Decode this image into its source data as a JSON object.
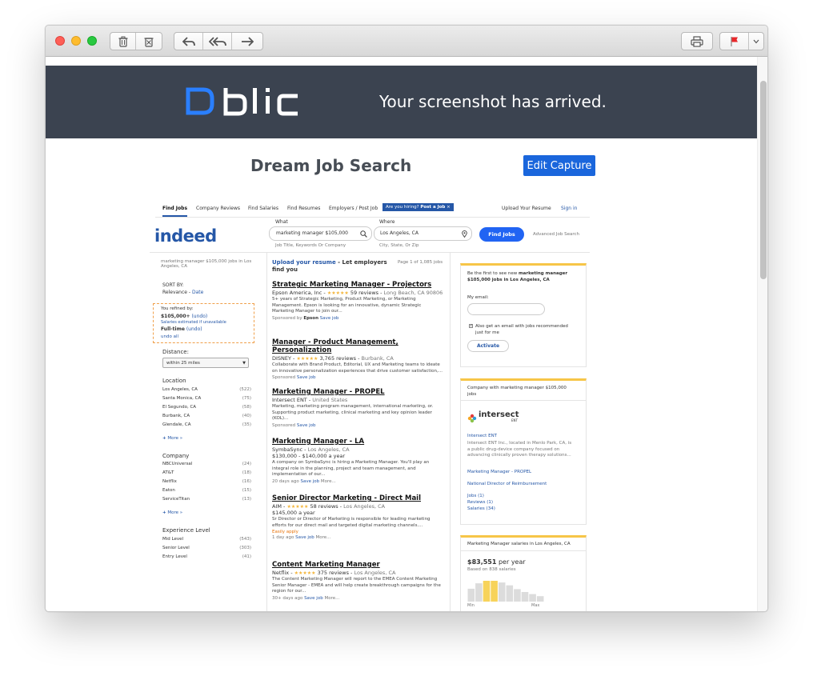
{
  "toolbar": {
    "icons": [
      "trash-icon",
      "junk-icon",
      "reply-icon",
      "reply-all-icon",
      "forward-icon",
      "print-icon",
      "flag-icon",
      "chevron-down-icon"
    ],
    "colors": {
      "close": "#fe5f57",
      "minimize": "#febc2e",
      "zoom": "#28c840",
      "flag": "#e8282b"
    }
  },
  "banner": {
    "logo_text": "blic",
    "tagline": "Your screenshot has arrived.",
    "background": "#3b4350",
    "logo_accent": "#2a7fff"
  },
  "page": {
    "title": "Dream Job Search",
    "edit_button": "Edit Capture"
  },
  "indeed": {
    "nav": {
      "items": [
        "Find Jobs",
        "Company Reviews",
        "Find Salaries",
        "Find Resumes",
        "Employers / Post Job"
      ],
      "hiring_prompt": "Are you hiring?",
      "post_job": "Post a Job",
      "close": "×",
      "upload_resume": "Upload Your Resume",
      "sign_in": "Sign in"
    },
    "logo": "indeed",
    "search": {
      "what_label": "What",
      "what_value": "marketing manager $105,000",
      "what_hint": "Job Title, Keywords Or Company",
      "where_label": "Where",
      "where_value": "Los Angeles, CA",
      "where_hint": "City, State, Or Zip",
      "find_button": "Find Jobs",
      "advanced": "Advanced Job Search"
    },
    "left": {
      "breadcrumb_line1": "marketing manager $105,000 jobs in Los",
      "breadcrumb_line2": "Angeles, CA",
      "sort_label": "SORT BY:",
      "sort_relevance": "Relevance",
      "sort_sep": " - ",
      "sort_date": "Date",
      "refined_label": "You refined by:",
      "refined_salary": "$105,000+",
      "undo": "(undo)",
      "salary_note": "Salaries estimated if unavailable",
      "refined_type": "Full-time",
      "undo_all": "undo all",
      "distance_label": "Distance:",
      "distance_value": "within 25 miles",
      "location_title": "Location",
      "locations": [
        {
          "name": "Los Angeles, CA",
          "count": "(522)"
        },
        {
          "name": "Santa Monica, CA",
          "count": "(75)"
        },
        {
          "name": "El Segundo, CA",
          "count": "(58)"
        },
        {
          "name": "Burbank, CA",
          "count": "(40)"
        },
        {
          "name": "Glendale, CA",
          "count": "(35)"
        }
      ],
      "more": "More »",
      "company_title": "Company",
      "companies": [
        {
          "name": "NBCUniversal",
          "count": "(24)"
        },
        {
          "name": "AT&T",
          "count": "(18)"
        },
        {
          "name": "Netflix",
          "count": "(16)"
        },
        {
          "name": "Eaton",
          "count": "(15)"
        },
        {
          "name": "ServiceTitan",
          "count": "(13)"
        }
      ],
      "experience_title": "Experience Level",
      "experience": [
        {
          "name": "Mid Level",
          "count": "(543)"
        },
        {
          "name": "Senior Level",
          "count": "(303)"
        },
        {
          "name": "Entry Level",
          "count": "(41)"
        }
      ]
    },
    "results": {
      "upload_link": "Upload your resume",
      "upload_rest": " - Let employers",
      "upload_rest2": "find you",
      "page_info": "Page 1 of 1,085 jobs",
      "jobs": [
        {
          "title": "Strategic Marketing Manager - Projectors",
          "company": "Epson America, Inc -",
          "stars": "★★★★★",
          "reviews": "59 reviews -",
          "location": "Long Beach, CA 90806",
          "salary": "",
          "desc": "5+ years of Strategic Marketing, Product Marketing, or Marketing Management. Epson is looking for an innovative, dynamic Strategic Marketing Manager to join our...",
          "meta": "Sponsored by",
          "meta_bold": "Epson",
          "save": "Save job",
          "more": "",
          "easy": ""
        },
        {
          "title": "Manager - Product Management, Personalization",
          "company": "DISNEY -",
          "stars": "★★★★★",
          "reviews": "3,765 reviews -",
          "location": "Burbank, CA",
          "salary": "",
          "desc": "Collaborate with Brand Product, Editorial, UX and Marketing teams to ideate on innovative personalization experiences that drive customer satisfaction,...",
          "meta": "Sponsored",
          "meta_bold": "",
          "save": "Save job",
          "more": "",
          "easy": ""
        },
        {
          "title": "Marketing Manager - PROPEL",
          "company": "Intersect ENT -",
          "stars": "",
          "reviews": "",
          "location": "United States",
          "salary": "",
          "desc": "Marketing, marketing program management, international marketing, or. Supporting product marketing, clinical marketing and key opinion leader (KOL)...",
          "meta": "Sponsored",
          "meta_bold": "",
          "save": "Save job",
          "more": "",
          "easy": ""
        },
        {
          "title": "Marketing Manager - LA",
          "company": "SymbaSync -",
          "stars": "",
          "reviews": "",
          "location": "Los Angeles, CA",
          "salary": "$130,000 - $140,000 a year",
          "desc": "A company on SymbaSync is hiring a Marketing Manager. You'll play an integral role in the planning, project and team management, and implementation of our...",
          "meta": "20 days ago",
          "meta_bold": "",
          "save": "Save job",
          "more": "More...",
          "easy": ""
        },
        {
          "title": "Senior Director Marketing - Direct Mail",
          "company": "AIM -",
          "stars": "★★★★★",
          "reviews": "58 reviews -",
          "location": "Los Angeles, CA",
          "salary": "$145,000 a year",
          "desc": "Sr Director or Director of Marketing is responsible for leading marketing efforts for our direct mail and targeted digital marketing channels....",
          "meta": "1 day ago",
          "meta_bold": "",
          "save": "Save job",
          "more": "More...",
          "easy": "Easily apply"
        },
        {
          "title": "Content Marketing Manager",
          "company": "Netflix -",
          "stars": "★★★★★",
          "reviews": "375 reviews -",
          "location": "Los Angeles, CA",
          "salary": "",
          "desc": "The Content Marketing Manager will report to the EMEA Content Marketing Senior Manager - EMEA and will help create breakthrough campaigns for the region for our...",
          "meta": "30+ days ago",
          "meta_bold": "",
          "save": "Save job",
          "more": "More...",
          "easy": ""
        }
      ]
    },
    "right": {
      "alert_line1": "Be the first to see new",
      "alert_bold1": "marketing manager",
      "alert_bold2": "$105,000 jobs in Los Angeles, CA",
      "email_label": "My email:",
      "also_line1": "Also get an email with jobs recommended",
      "also_line2": "just for me",
      "activate": "Activate",
      "company_header_line1": "Company with marketing manager $105,000",
      "company_header_line2": "jobs",
      "company_logo_text": "intersect",
      "company_logo_sub": "ENT",
      "company_name": "Intersect ENT",
      "company_desc": [
        "Intersect ENT Inc., located in Menlo Park, CA, is",
        "a public drug-device company focused on",
        "advancing clinically proven therapy solutions..."
      ],
      "company_job1": "Marketing Manager - PROPEL",
      "company_job2": "National Director of Reimbursement",
      "company_links": [
        "Jobs (1)",
        "Reviews (1)",
        "Salaries (34)"
      ],
      "salary_header": "Marketing Manager salaries in Los Angeles, CA",
      "salary_value": "$83,551",
      "salary_period": " per year",
      "salary_based": "Based on 838 salaries",
      "salary_histogram": [
        0.62,
        0.88,
        1.0,
        1.0,
        0.92,
        0.78,
        0.6,
        0.46,
        0.36,
        0.26
      ],
      "hist_min": "Min",
      "hist_max": "Max"
    }
  }
}
